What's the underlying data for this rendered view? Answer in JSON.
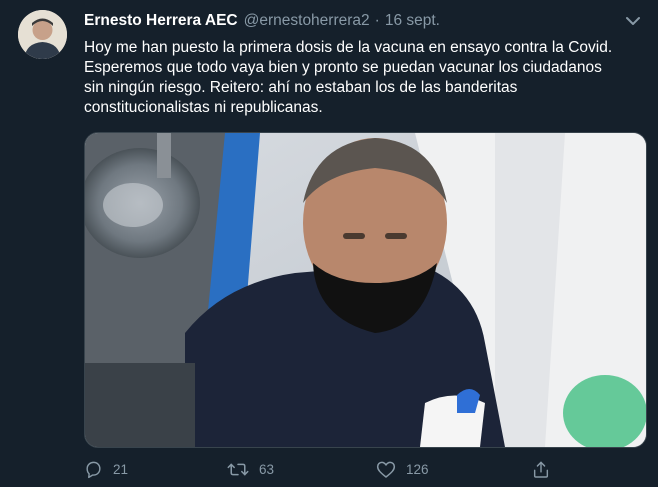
{
  "tweet": {
    "author_name": "Ernesto Herrera AEC",
    "handle": "@ernestoherrera2",
    "separator": "·",
    "date": "16 sept.",
    "text_lines": [
      "Hoy me han puesto la primera dosis de la vacuna en ensayo contra la Covid.",
      "Esperemos que todo vaya bien y pronto se puedan vacunar los ciudadanos",
      "sin ningún riesgo. Reitero: ahí no estaban los de las banderitas",
      "constitucionalistas ni republicanas."
    ],
    "media_icon": "photo-image",
    "caret_icon": "chevron-down-icon"
  },
  "actions": {
    "reply": {
      "icon": "reply-icon",
      "count": "21"
    },
    "retweet": {
      "icon": "retweet-icon",
      "count": "63"
    },
    "like": {
      "icon": "heart-icon",
      "count": "126"
    },
    "share": {
      "icon": "share-icon"
    }
  },
  "colors": {
    "background": "#15202b",
    "text": "#ffffff",
    "secondary": "#8899a6",
    "border": "#38444d"
  }
}
